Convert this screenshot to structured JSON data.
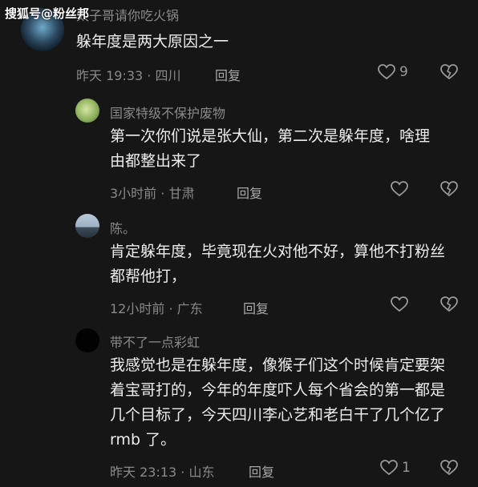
{
  "watermark": "搜狐号@粉丝邦",
  "comments": [
    {
      "user": "太子哥请你吃火锅",
      "text": "躲年度是两大原因之一",
      "time_location": "昨天 19:33 · 四川",
      "reply_label": "回复",
      "likes": "9"
    },
    {
      "user": "国家特级不保护废物",
      "text": "第一次你们说是张大仙，第二次是躲年度，啥理由都整出来了",
      "time_location": "3小时前 · 甘肃",
      "reply_label": "回复",
      "likes": ""
    },
    {
      "user": "陈。",
      "text": "肯定躲年度，毕竟现在火对他不好，算他不打粉丝都帮他打，",
      "time_location": "12小时前 · 广东",
      "reply_label": "回复",
      "likes": ""
    },
    {
      "user": "带不了一点彩虹",
      "text": "我感觉也是在躲年度，像猴子们这个时候肯定要架着宝哥打的，今年的年度吓人每个省会的第一都是几个目标了，今天四川李心艺和老白干了几个亿了 rmb 了。",
      "time_location": "昨天 23:13 · 山东",
      "reply_label": "回复",
      "likes": "1"
    }
  ],
  "icons": {
    "like": "heart-outline-icon",
    "dislike": "broken-heart-icon"
  }
}
